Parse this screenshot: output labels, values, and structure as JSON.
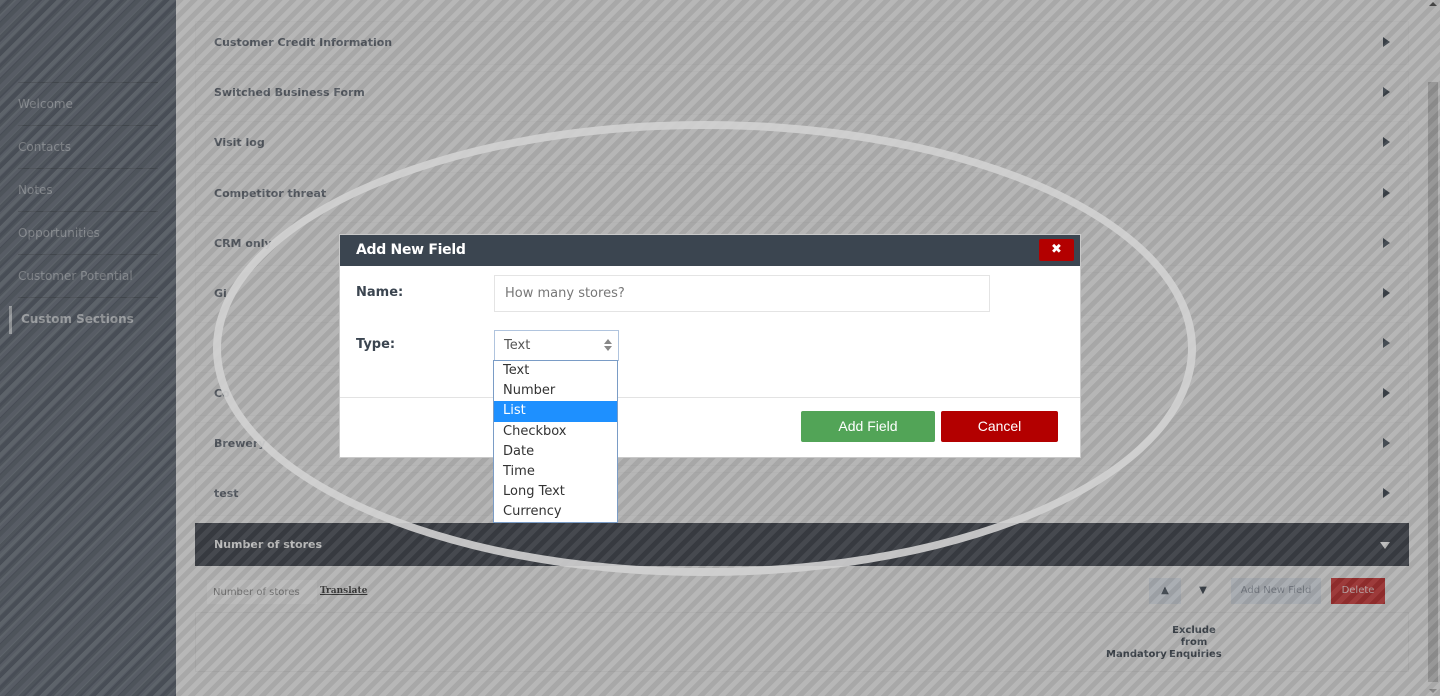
{
  "sidebar": {
    "items": [
      {
        "label": "Welcome"
      },
      {
        "label": "Contacts"
      },
      {
        "label": "Notes"
      },
      {
        "label": "Opportunities"
      },
      {
        "label": "Customer Potential"
      },
      {
        "label": "Custom Sections",
        "active": true
      }
    ]
  },
  "sections": [
    {
      "title": "Customer Credit Information"
    },
    {
      "title": "Switched Business Form"
    },
    {
      "title": "Visit log"
    },
    {
      "title": "Competitor threat"
    },
    {
      "title": "CRM only"
    },
    {
      "title": "Gi"
    },
    {
      "title": ""
    },
    {
      "title": "Co"
    },
    {
      "title": "Brewery"
    },
    {
      "title": "test"
    }
  ],
  "expanded_section": {
    "title": "Number of stores",
    "name_input_value": "Number of stores",
    "translate_label": "Translate",
    "up_label": "▲",
    "down_label": "▼",
    "add_new_field_label": "Add New Field",
    "delete_label": "Delete",
    "columns": {
      "mandatory": "Mandatory",
      "exclude": "Exclude from Enquiries"
    }
  },
  "modal": {
    "title": "Add New Field",
    "close_icon": "✖",
    "name_label": "Name:",
    "name_value": "How many stores?",
    "type_label": "Type:",
    "type_selected": "Text",
    "type_options": [
      "Text",
      "Number",
      "List",
      "Checkbox",
      "Date",
      "Time",
      "Long Text",
      "Currency"
    ],
    "type_highlighted": "List",
    "add_button": "Add Field",
    "cancel_button": "Cancel"
  },
  "colors": {
    "header": "#3b4550",
    "danger": "#b30000",
    "success": "#52a457",
    "highlight": "#1e90ff"
  }
}
